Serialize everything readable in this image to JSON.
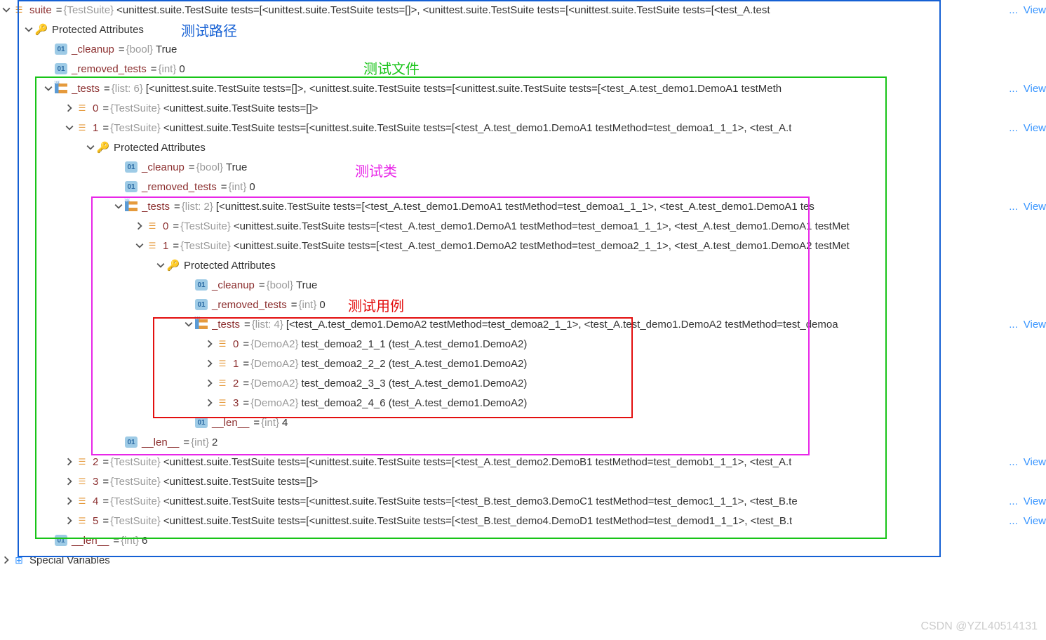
{
  "labels": {
    "test_path": "测试路径",
    "test_file": "测试文件",
    "test_class": "测试类",
    "test_case": "测试用例"
  },
  "watermark": "CSDN @YZL40514131",
  "view": "View",
  "dots": "...",
  "icon01": "01",
  "special_vars": "Special Variables",
  "protected_attrs": "Protected Attributes",
  "root": {
    "name": "suite",
    "type": "{TestSuite}",
    "value": "<unittest.suite.TestSuite tests=[<unittest.suite.TestSuite tests=[]>, <unittest.suite.TestSuite tests=[<unittest.suite.TestSuite tests=[<test_A.test"
  },
  "lvl1": {
    "cleanup": {
      "name": "_cleanup",
      "type": "{bool}",
      "value": "True"
    },
    "removed": {
      "name": "_removed_tests",
      "type": "{int}",
      "value": "0"
    },
    "tests": {
      "name": "_tests",
      "type": "{list: 6}",
      "value": "[<unittest.suite.TestSuite tests=[]>, <unittest.suite.TestSuite tests=[<unittest.suite.TestSuite tests=[<test_A.test_demo1.DemoA1 testMeth"
    },
    "len": {
      "name": "__len__",
      "type": "{int}",
      "value": "6"
    }
  },
  "items1": {
    "i0": {
      "name": "0",
      "type": "{TestSuite}",
      "value": "<unittest.suite.TestSuite tests=[]>"
    },
    "i1": {
      "name": "1",
      "type": "{TestSuite}",
      "value": "<unittest.suite.TestSuite tests=[<unittest.suite.TestSuite tests=[<test_A.test_demo1.DemoA1 testMethod=test_demoa1_1_1>, <test_A.t"
    },
    "i2": {
      "name": "2",
      "type": "{TestSuite}",
      "value": "<unittest.suite.TestSuite tests=[<unittest.suite.TestSuite tests=[<test_A.test_demo2.DemoB1 testMethod=test_demob1_1_1>, <test_A.t"
    },
    "i3": {
      "name": "3",
      "type": "{TestSuite}",
      "value": "<unittest.suite.TestSuite tests=[]>"
    },
    "i4": {
      "name": "4",
      "type": "{TestSuite}",
      "value": "<unittest.suite.TestSuite tests=[<unittest.suite.TestSuite tests=[<test_B.test_demo3.DemoC1 testMethod=test_democ1_1_1>, <test_B.te"
    },
    "i5": {
      "name": "5",
      "type": "{TestSuite}",
      "value": "<unittest.suite.TestSuite tests=[<unittest.suite.TestSuite tests=[<test_B.test_demo4.DemoD1 testMethod=test_demod1_1_1>, <test_B.t"
    }
  },
  "lvl2": {
    "cleanup": {
      "name": "_cleanup",
      "type": "{bool}",
      "value": "True"
    },
    "removed": {
      "name": "_removed_tests",
      "type": "{int}",
      "value": "0"
    },
    "tests": {
      "name": "_tests",
      "type": "{list: 2}",
      "value": "[<unittest.suite.TestSuite tests=[<test_A.test_demo1.DemoA1 testMethod=test_demoa1_1_1>, <test_A.test_demo1.DemoA1 tes"
    },
    "len": {
      "name": "__len__",
      "type": "{int}",
      "value": "2"
    }
  },
  "items2": {
    "i0": {
      "name": "0",
      "type": "{TestSuite}",
      "value": "<unittest.suite.TestSuite tests=[<test_A.test_demo1.DemoA1 testMethod=test_demoa1_1_1>, <test_A.test_demo1.DemoA1 testMet"
    },
    "i1": {
      "name": "1",
      "type": "{TestSuite}",
      "value": "<unittest.suite.TestSuite tests=[<test_A.test_demo1.DemoA2 testMethod=test_demoa2_1_1>, <test_A.test_demo1.DemoA2 testMet"
    }
  },
  "lvl3": {
    "cleanup": {
      "name": "_cleanup",
      "type": "{bool}",
      "value": "True"
    },
    "removed": {
      "name": "_removed_tests",
      "type": "{int}",
      "value": "0"
    },
    "tests": {
      "name": "_tests",
      "type": "{list: 4}",
      "value": "[<test_A.test_demo1.DemoA2 testMethod=test_demoa2_1_1>, <test_A.test_demo1.DemoA2 testMethod=test_demoa"
    },
    "len": {
      "name": "__len__",
      "type": "{int}",
      "value": "4"
    }
  },
  "items3": {
    "i0": {
      "name": "0",
      "type": "{DemoA2}",
      "value": "test_demoa2_1_1 (test_A.test_demo1.DemoA2)"
    },
    "i1": {
      "name": "1",
      "type": "{DemoA2}",
      "value": "test_demoa2_2_2 (test_A.test_demo1.DemoA2)"
    },
    "i2": {
      "name": "2",
      "type": "{DemoA2}",
      "value": "test_demoa2_3_3 (test_A.test_demo1.DemoA2)"
    },
    "i3": {
      "name": "3",
      "type": "{DemoA2}",
      "value": "test_demoa2_4_6 (test_A.test_demo1.DemoA2)"
    }
  }
}
